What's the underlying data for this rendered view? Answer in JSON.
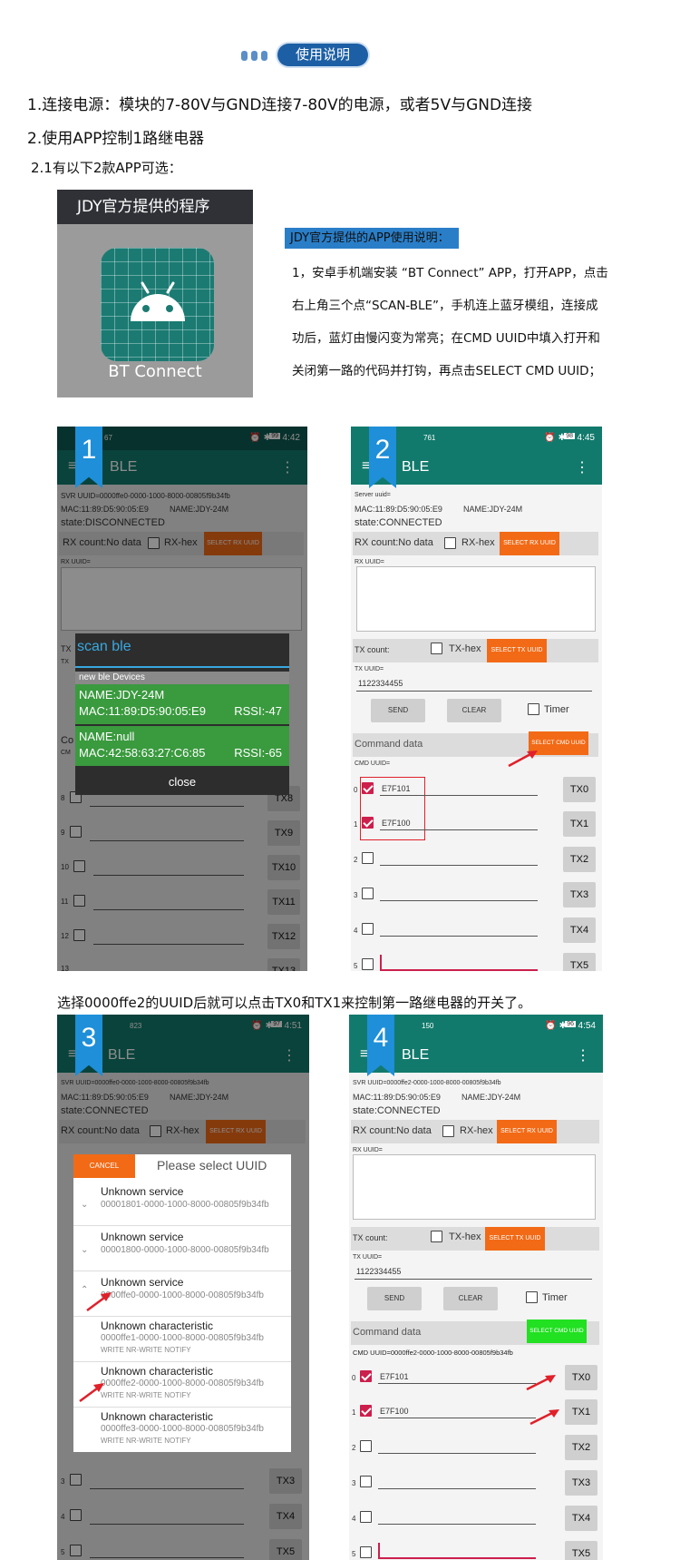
{
  "header": {
    "title": "使用说明"
  },
  "intro": {
    "line1": "1.连接电源：模块的7-80V与GND连接7-80V的电源，或者5V与GND连接",
    "line2": "2.使用APP控制1路继电器",
    "line3": "2.1有以下2款APP可选："
  },
  "app_card": {
    "title": "JDY官方提供的程序",
    "app_name": "BT Connect"
  },
  "instructions": {
    "title": "JDY官方提供的APP使用说明：",
    "lines": [
      "1，安卓手机端安装 “BT Connect” APP，打开APP，点击",
      "右上角三个点“SCAN-BLE”，手机连上蓝牙模组，连接成",
      "功后，蓝灯由慢闪变为常亮；在CMD UUID中填入打开和",
      "关闭第一路的代码并打钩，再点击SELECT CMD UUID；"
    ]
  },
  "middle_caption": "选择0000ffe2的UUID后就可以点击TX0和TX1来控制第一路继电器的开关了。",
  "shots": {
    "s1": {
      "num": "1",
      "time": "4:42",
      "net": "67",
      "batt": "99",
      "app_title": "BLE",
      "svr": "SVR UUID=0000ffe0-0000-1000-8000-00805f9b34fb",
      "mac": "MAC:11:89:D5:90:05:E9",
      "name": "NAME:JDY-24M",
      "state": "state:DISCONNECTED",
      "rxcount": "RX count:No data",
      "rxhex": "RX-hex",
      "select_rx": "SELECT RX UUID",
      "rx_uuid": "RX UUID=",
      "dialog_title": "scan ble",
      "dialog_section": "new ble Devices",
      "dev1_name": "NAME:JDY-24M",
      "dev1_mac": "MAC:11:89:D5:90:05:E9",
      "dev1_rssi": "RSSI:-47",
      "dev2_name": "NAME:null",
      "dev2_mac": "MAC:42:58:63:27:C6:85",
      "dev2_rssi": "RSSI:-65",
      "close": "close",
      "tx_partial": "TX",
      "co_partial": "Co",
      "cm_partial": "CM",
      "rows": [
        {
          "n": "8",
          "tx": "TX8"
        },
        {
          "n": "9",
          "tx": "TX9"
        },
        {
          "n": "10",
          "tx": "TX10"
        },
        {
          "n": "11",
          "tx": "TX11"
        },
        {
          "n": "12",
          "tx": "TX12"
        },
        {
          "n": "13",
          "tx": "TX13"
        }
      ]
    },
    "s2": {
      "num": "2",
      "time": "4:45",
      "net": "761",
      "batt": "98",
      "app_title": "BLE",
      "svr": "Server uuid=",
      "mac": "MAC:11:89:D5:90:05:E9",
      "name": "NAME:JDY-24M",
      "state": "state:CONNECTED",
      "rxcount": "RX count:No data",
      "rxhex": "RX-hex",
      "select_rx": "SELECT RX UUID",
      "rx_uuid": "RX UUID=",
      "txcount": "TX count:",
      "txhex": "TX-hex",
      "select_tx": "SELECT TX UUID",
      "tx_uuid": "TX UUID=",
      "tx_value": "1122334455",
      "send": "SEND",
      "clear": "CLEAR",
      "timer": "Timer",
      "cmd_data": "Command data",
      "select_cmd": "SELECT CMD UUID",
      "cmd_uuid": "CMD UUID=",
      "rows": [
        {
          "n": "0",
          "v": "E7F101",
          "tx": "TX0"
        },
        {
          "n": "1",
          "v": "E7F100",
          "tx": "TX1"
        },
        {
          "n": "2",
          "v": "",
          "tx": "TX2"
        },
        {
          "n": "3",
          "v": "",
          "tx": "TX3"
        },
        {
          "n": "4",
          "v": "",
          "tx": "TX4"
        },
        {
          "n": "5",
          "v": "",
          "tx": "TX5"
        }
      ]
    },
    "s3": {
      "num": "3",
      "time": "4:51",
      "net": "823",
      "batt": "97",
      "app_title": "BLE",
      "svr": "SVR UUID=0000ffe0-0000-1000-8000-00805f9b34fb",
      "mac": "MAC:11:89:D5:90:05:E9",
      "name": "NAME:JDY-24M",
      "state": "state:CONNECTED",
      "rxcount": "RX count:No data",
      "rxhex": "RX-hex",
      "select_rx": "SELECT RX UUID",
      "cancel": "CANCEL",
      "dialog_title": "Please select UUID",
      "items": [
        {
          "t": "Unknown service",
          "u": "00001801-0000-1000-8000-00805f9b34fb",
          "p": ""
        },
        {
          "t": "Unknown service",
          "u": "00001800-0000-1000-8000-00805f9b34fb",
          "p": ""
        },
        {
          "t": "Unknown service",
          "u": "0000ffe0-0000-1000-8000-00805f9b34fb",
          "p": ""
        },
        {
          "t": "Unknown characteristic",
          "u": "0000ffe1-0000-1000-8000-00805f9b34fb",
          "p": "WRITE NR-WRITE NOTIFY"
        },
        {
          "t": "Unknown characteristic",
          "u": "0000ffe2-0000-1000-8000-00805f9b34fb",
          "p": "WRITE NR-WRITE NOTIFY"
        },
        {
          "t": "Unknown characteristic",
          "u": "0000ffe3-0000-1000-8000-00805f9b34fb",
          "p": "WRITE NR-WRITE NOTIFY"
        }
      ],
      "tx3": "TX3",
      "tx4": "TX4",
      "tx5": "TX5",
      "n3": "3",
      "n4": "4",
      "n5": "5"
    },
    "s4": {
      "num": "4",
      "time": "4:54",
      "net": "150",
      "batt": "96",
      "app_title": "BLE",
      "svr": "SVR UUID=0000ffe2-0000-1000-8000-00805f9b34fb",
      "mac": "MAC:11:89:D5:90:05:E9",
      "name": "NAME:JDY-24M",
      "state": "state:CONNECTED",
      "rxcount": "RX count:No data",
      "rxhex": "RX-hex",
      "select_rx": "SELECT RX UUID",
      "rx_uuid": "RX UUID=",
      "txcount": "TX count:",
      "txhex": "TX-hex",
      "select_tx": "SELECT TX UUID",
      "tx_uuid": "TX UUID=",
      "tx_value": "1122334455",
      "send": "SEND",
      "clear": "CLEAR",
      "timer": "Timer",
      "cmd_data": "Command data",
      "select_cmd": "SELECT CMD UUID",
      "cmd_uuid": "CMD UUID=0000ffe2-0000-1000-8000-00805f9b34fb",
      "rows": [
        {
          "n": "0",
          "v": "E7F101",
          "tx": "TX0"
        },
        {
          "n": "1",
          "v": "E7F100",
          "tx": "TX1"
        },
        {
          "n": "2",
          "v": "",
          "tx": "TX2"
        },
        {
          "n": "3",
          "v": "",
          "tx": "TX3"
        },
        {
          "n": "4",
          "v": "",
          "tx": "TX4"
        },
        {
          "n": "5",
          "v": "",
          "tx": "TX5"
        }
      ]
    }
  },
  "colors": {
    "teal": "#127a6c",
    "orange": "#f26a16",
    "green": "#3a9a3e",
    "lime": "#22e022",
    "pink": "#cc1f4c",
    "blue": "#2a7ec8"
  }
}
